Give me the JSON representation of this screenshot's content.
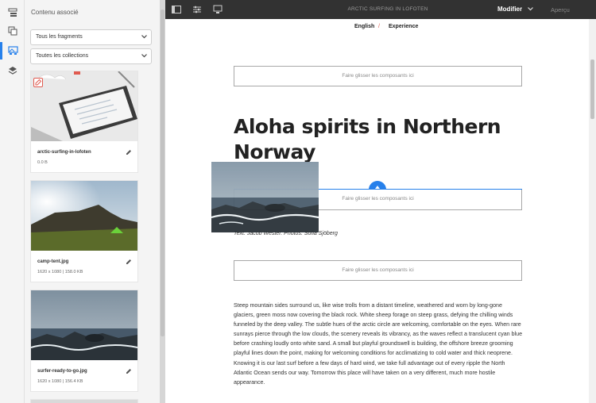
{
  "rail": {
    "items": [
      {
        "name": "page-tree-icon"
      },
      {
        "name": "components-icon"
      },
      {
        "name": "assets-icon"
      },
      {
        "name": "layers-icon"
      }
    ]
  },
  "panel": {
    "title": "Contenu associé",
    "filter_fragments": "Tous les fragments",
    "filter_collections": "Toutes les collections",
    "cards": [
      {
        "name": "arctic-surfing-in-lofoten",
        "meta": "0.0 B"
      },
      {
        "name": "camp-tent.jpg",
        "meta": "1620 x 1080 | 158.0 KB"
      },
      {
        "name": "surfer-ready-to-go.jpg",
        "meta": "1620 x 1080 | 156.4 KB"
      }
    ]
  },
  "topbar": {
    "title": "ARCTIC SURFING IN LOFOTEN",
    "mode": "Modifier",
    "preview": "Aperçu"
  },
  "page": {
    "lang": "English",
    "lang_sep": "/",
    "section": "Experience",
    "dropzone_label": "Faire glisser les composants ici",
    "heading": "Aloha spirits in Northern Norway",
    "caption": "Text: Jacob Wester. Photos: Sofia Sjöberg",
    "body": "Steep mountain sides surround us, like wise trolls from a distant timeline, weathered and worn by long-gone glaciers, green moss now covering the black rock. White sheep forage on steep grass, defying the chilling winds funneled by the deep valley. The subtle hues of the arctic circle are welcoming, comfortable on the eyes. When rare sunrays pierce through the low clouds, the scenery reveals its vibrancy, as the waves reflect a translucent cyan blue before crashing loudly onto white sand. A small but playful groundswell is building, the offshore breeze grooming playful lines down the point, making for welcoming conditions for acclimatizing to cold water and thick neoprene. Knowing it is our last surf before a few days of hard wind, we take full advantage out of every ripple the North Atlantic Ocean sends our way. Tomorrow this place will have taken on a very different, much more hostile appearance."
  },
  "colors": {
    "accent": "#2680eb",
    "topbar": "#323232",
    "lang_separator": "#e05a4f"
  }
}
